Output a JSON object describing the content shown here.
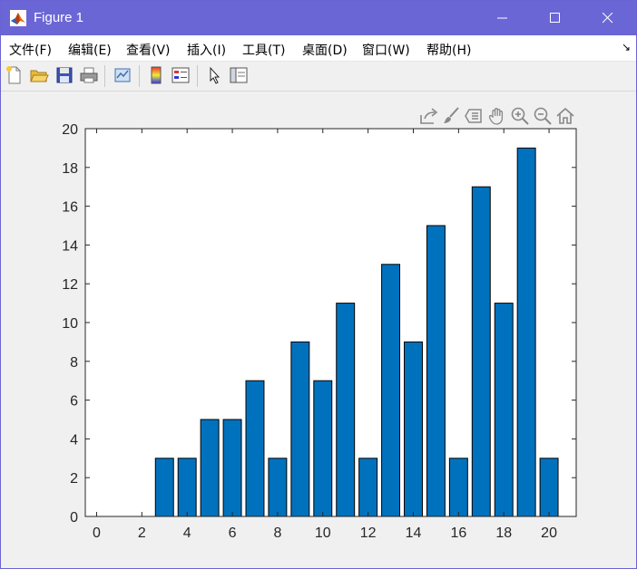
{
  "window": {
    "title": "Figure 1"
  },
  "menu": {
    "items": [
      "文件(F)",
      "编辑(E)",
      "查看(V)",
      "插入(I)",
      "工具(T)",
      "桌面(D)",
      "窗口(W)",
      "帮助(H)"
    ],
    "overflow_glyph": "↘"
  },
  "toolbar": {
    "buttons": [
      "new-figure-icon",
      "open-file-icon",
      "save-icon",
      "print-icon",
      "link-plot-icon",
      "colorbar-icon",
      "legend-icon",
      "edit-plot-pointer-icon",
      "property-inspector-icon"
    ]
  },
  "axes_toolbar": {
    "buttons": [
      "export-icon",
      "brush-icon",
      "data-tips-icon",
      "pan-icon",
      "zoom-in-icon",
      "zoom-out-icon",
      "home-icon"
    ]
  },
  "colors": {
    "bar": "#0072bd",
    "title_bar": "#6b66d6"
  },
  "chart_data": {
    "type": "bar",
    "x": [
      3,
      4,
      5,
      6,
      7,
      8,
      9,
      10,
      11,
      12,
      13,
      14,
      15,
      16,
      17,
      18,
      19,
      20
    ],
    "values": [
      3,
      3,
      5,
      5,
      7,
      3,
      9,
      7,
      11,
      3,
      13,
      9,
      15,
      3,
      17,
      11,
      19,
      3
    ],
    "xlim": [
      -0.5,
      21.2
    ],
    "ylim": [
      0,
      20
    ],
    "xticks": [
      0,
      2,
      4,
      6,
      8,
      10,
      12,
      14,
      16,
      18,
      20
    ],
    "yticks": [
      0,
      2,
      4,
      6,
      8,
      10,
      12,
      14,
      16,
      18,
      20
    ],
    "grid": false
  }
}
